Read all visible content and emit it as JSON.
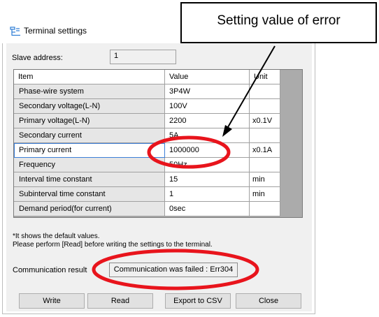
{
  "window": {
    "title": "Terminal settings"
  },
  "slave": {
    "label": "Slave address:",
    "value": "1"
  },
  "grid": {
    "headers": {
      "item": "Item",
      "value": "Value",
      "unit": "Unit"
    },
    "rows": [
      {
        "item": "Phase-wire system",
        "value": "3P4W",
        "unit": ""
      },
      {
        "item": "Secondary voltage(L-N)",
        "value": "100V",
        "unit": ""
      },
      {
        "item": "Primary voltage(L-N)",
        "value": "2200",
        "unit": "x0.1V"
      },
      {
        "item": "Secondary current",
        "value": "5A",
        "unit": ""
      },
      {
        "item": "Primary current",
        "value": "1000000",
        "unit": "x0.1A"
      },
      {
        "item": "Frequency",
        "value": "50Hz",
        "unit": ""
      },
      {
        "item": "Interval time constant",
        "value": "15",
        "unit": "min"
      },
      {
        "item": "Subinterval time constant",
        "value": "1",
        "unit": "min"
      },
      {
        "item": "Demand period(for current)",
        "value": "0sec",
        "unit": ""
      }
    ]
  },
  "notes": {
    "line1": "*It shows the default values.",
    "line2": "Please perform [Read] before writing the settings to the terminal."
  },
  "communication": {
    "label": "Communication result",
    "value": "Communication was failed : Err304"
  },
  "buttons": {
    "write": "Write",
    "read": "Read",
    "export": "Export to CSV",
    "close": "Close"
  },
  "callout": {
    "text": "Setting value of error"
  },
  "colors": {
    "highlight_ellipse": "#e8141c",
    "selection_border": "#3c7fd8",
    "grid_background": "#ababab"
  },
  "icons": {
    "title": "terminal-settings-icon"
  }
}
